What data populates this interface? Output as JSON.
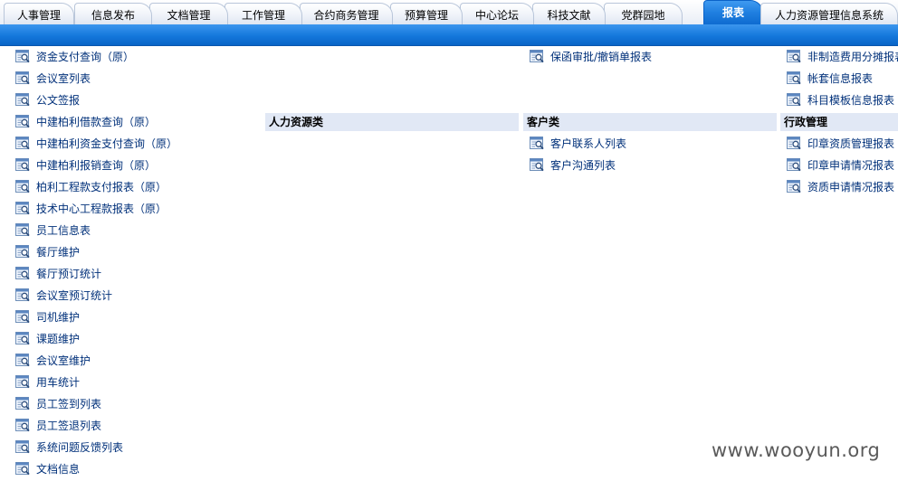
{
  "tabs": [
    {
      "label": "人事管理"
    },
    {
      "label": "信息发布"
    },
    {
      "label": "文档管理"
    },
    {
      "label": "工作管理"
    },
    {
      "label": "合约商务管理"
    },
    {
      "label": "预算管理"
    },
    {
      "label": "中心论坛"
    },
    {
      "label": "科技文献"
    },
    {
      "label": "党群园地"
    },
    {
      "label": "报表",
      "active": true
    },
    {
      "label": "人力资源管理信息系统"
    }
  ],
  "columns": {
    "col1": {
      "items": [
        "资金支付查询（原）",
        "会议室列表",
        "公文签报",
        "中建柏利借款查询（原）",
        "中建柏利资金支付查询（原）",
        "中建柏利报销查询（原）",
        "柏利工程款支付报表（原）",
        "技术中心工程款报表（原）",
        "员工信息表",
        "餐厅维护",
        "餐厅预订统计",
        "会议室预订统计",
        "司机维护",
        "课题维护",
        "会议室维护",
        "用车统计",
        "员工签到列表",
        "员工签退列表",
        "系统问题反馈列表",
        "文档信息"
      ]
    },
    "col2": {
      "header": "人力资源类"
    },
    "col3": {
      "top_items": [
        "保函审批/撤销单报表"
      ],
      "header": "客户类",
      "items": [
        "客户联系人列表",
        "客户沟通列表"
      ]
    },
    "col4": {
      "top_items": [
        "非制造费用分摊报表",
        "帐套信息报表",
        "科目模板信息报表"
      ],
      "header": "行政管理",
      "items": [
        "印章资质管理报表",
        "印章申请情况报表",
        "资质申请情况报表"
      ]
    }
  },
  "icons": {
    "report": "report-search-icon"
  },
  "colors": {
    "link": "#00307a",
    "accent_blue": "#1478dc",
    "section_bg": "#e1e8f5"
  },
  "watermark": "www.wooyun.org"
}
